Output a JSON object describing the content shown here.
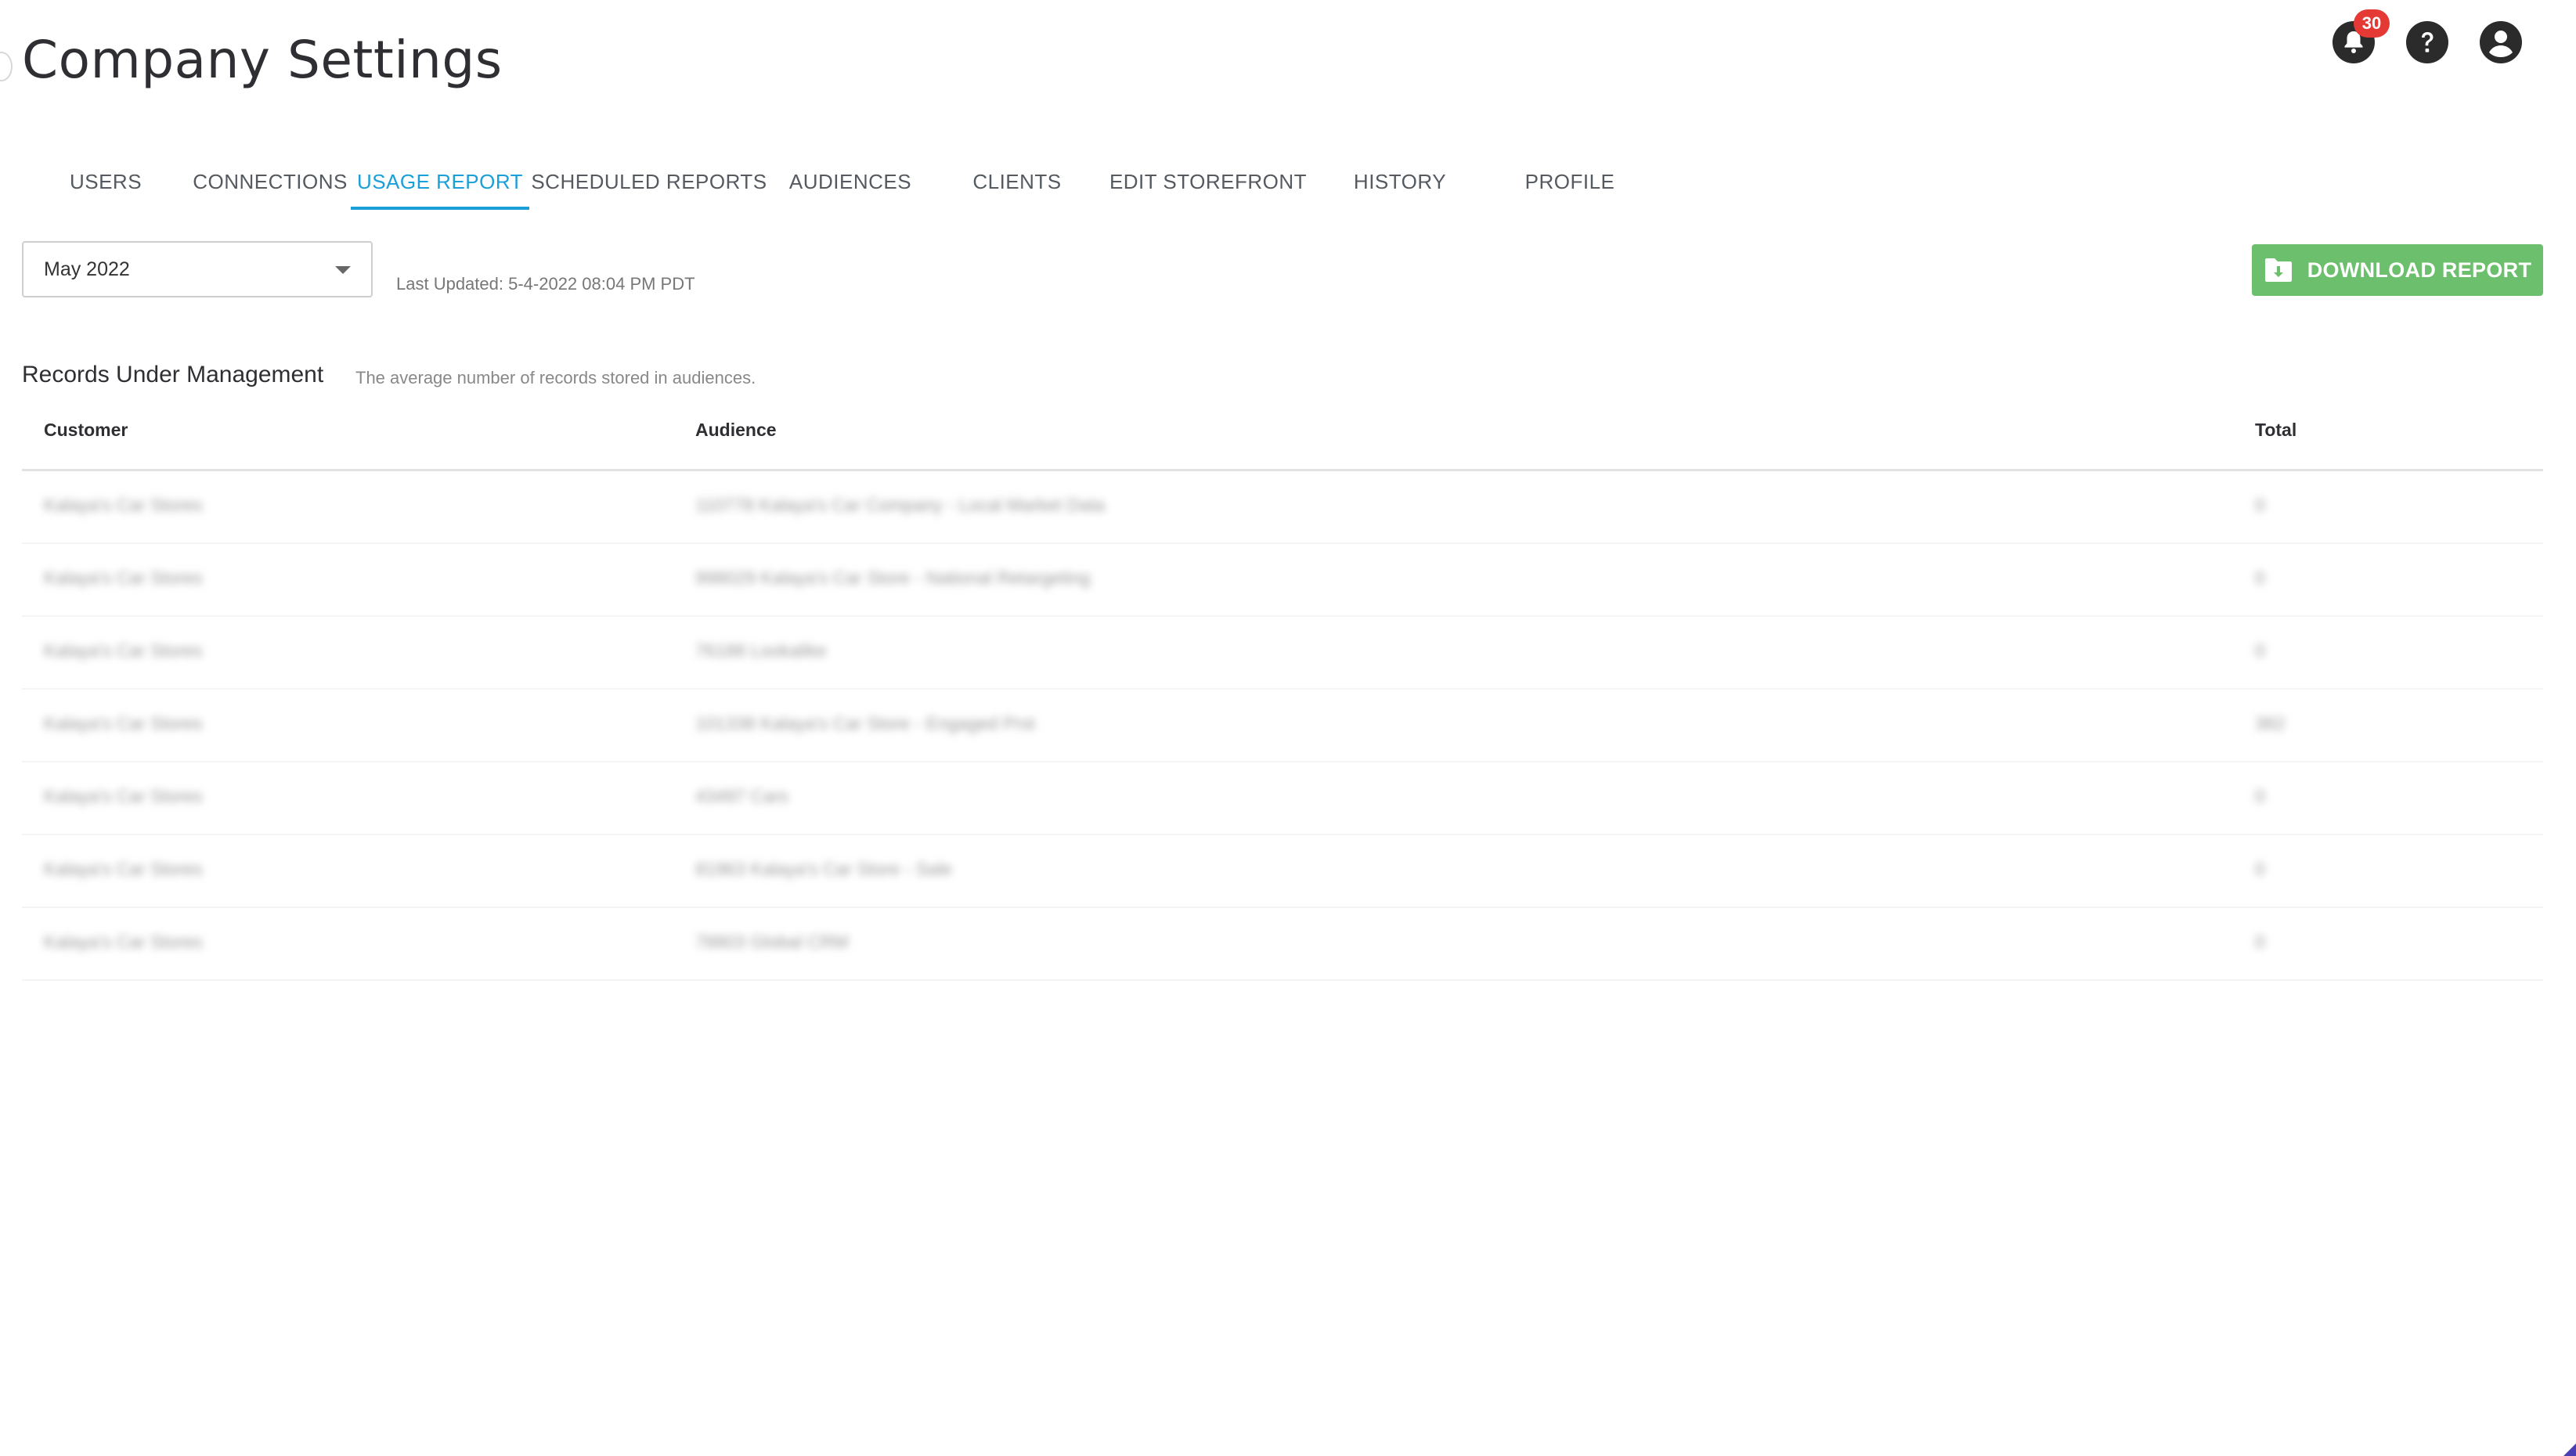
{
  "page": {
    "title": "Company Settings"
  },
  "header": {
    "notifications_count": "30"
  },
  "tabs": [
    {
      "label": "USERS",
      "active": false
    },
    {
      "label": "CONNECTIONS",
      "active": false
    },
    {
      "label": "USAGE REPORT",
      "active": true
    },
    {
      "label": "SCHEDULED REPORTS",
      "active": false
    },
    {
      "label": "AUDIENCES",
      "active": false
    },
    {
      "label": "CLIENTS",
      "active": false
    },
    {
      "label": "EDIT STOREFRONT",
      "active": false
    },
    {
      "label": "HISTORY",
      "active": false
    },
    {
      "label": "PROFILE",
      "active": false
    }
  ],
  "controls": {
    "month_selected": "May 2022",
    "last_updated": "Last Updated: 5-4-2022 08:04 PM PDT",
    "download_label": "DOWNLOAD REPORT"
  },
  "section": {
    "title": "Records Under Management",
    "subtitle": "The average number of records stored in audiences."
  },
  "table": {
    "headers": {
      "customer": "Customer",
      "audience": "Audience",
      "total": "Total"
    },
    "rows": [
      {
        "customer": "Kalaya's Car Stores",
        "audience": "110778 Kalaya's Car Company - Local Market Data",
        "total": "0"
      },
      {
        "customer": "Kalaya's Car Stores",
        "audience": "998029 Kalaya's Car Store - National Retargeting",
        "total": "0"
      },
      {
        "customer": "Kalaya's Car Stores",
        "audience": "76188 Lookalike",
        "total": "0"
      },
      {
        "customer": "Kalaya's Car Stores",
        "audience": "101338 Kalaya's Car Store - Engaged Prst",
        "total": "382"
      },
      {
        "customer": "Kalaya's Car Stores",
        "audience": "43497 Cars",
        "total": "0"
      },
      {
        "customer": "Kalaya's Car Stores",
        "audience": "81963 Kalaya's Car Store - Sale",
        "total": "0"
      },
      {
        "customer": "Kalaya's Car Stores",
        "audience": "78803 Global CRM",
        "total": "0"
      }
    ]
  },
  "colors": {
    "accent": "#1a9fd9",
    "download_button": "#6cbf6c",
    "badge": "#e53935"
  },
  "icons": [
    "bell-icon",
    "help-icon",
    "account-icon",
    "caret-down-icon",
    "folder-download-icon"
  ]
}
